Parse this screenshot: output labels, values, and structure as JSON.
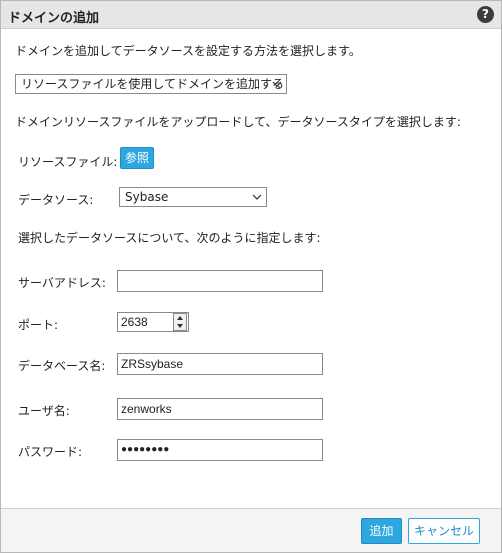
{
  "dialog": {
    "title": "ドメインの追加",
    "help_label": "?"
  },
  "intro_text": "ドメインを追加してデータソースを設定する方法を選択します。",
  "method_select": {
    "value": "リソースファイルを使用してドメインを追加する"
  },
  "resource_intro_text": "ドメインリソースファイルをアップロードして、データソースタイプを選択します:",
  "resource_file": {
    "label": "リソースファイル:",
    "browse_label": "参照"
  },
  "data_source": {
    "label": "データソース:",
    "value": "Sybase"
  },
  "spec_text": "選択したデータソースについて、次のように指定します:",
  "server_address": {
    "label": "サーバアドレス:",
    "value": ""
  },
  "port": {
    "label": "ポート:",
    "value": "2638"
  },
  "database_name": {
    "label": "データベース名:",
    "value": "ZRSsybase"
  },
  "username": {
    "label": "ユーザ名:",
    "value": "zenworks"
  },
  "password": {
    "label": "パスワード:",
    "value": "●●●●●●●●"
  },
  "footer": {
    "add_label": "追加",
    "cancel_label": "キャンセル"
  },
  "colors": {
    "accent": "#2ea6e0",
    "titlebar": "#e6e6e6"
  }
}
